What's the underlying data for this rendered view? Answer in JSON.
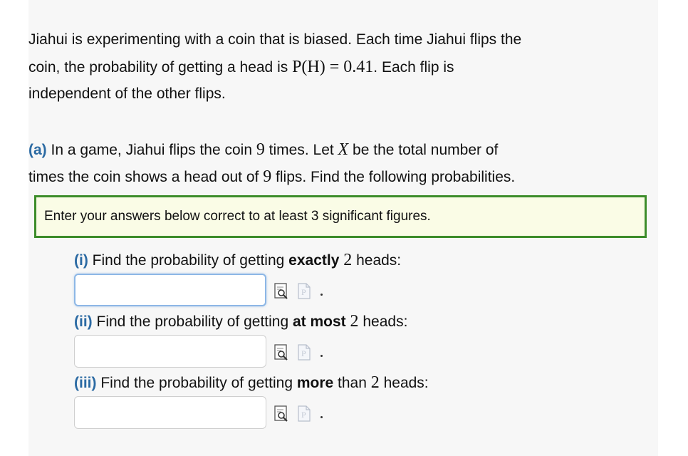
{
  "intro": {
    "text1": "Jiahui is experimenting with a coin that is biased. Each time Jiahui flips the",
    "text2a": "coin, the probability of getting a head is ",
    "math_PH": "P(H) = 0.41",
    "text2b": ". Each flip is",
    "text3": "independent of the other flips."
  },
  "part_a": {
    "label": "(a)",
    "text1a": " In a game, Jiahui flips the coin ",
    "n": "9",
    "text1b": " times.  Let ",
    "var": "X",
    "text1c": " be the total number of",
    "text2a": "times the coin shows a head out of ",
    "text2b": " flips. Find the following probabilities."
  },
  "note": "Enter your answers below correct to at least 3 significant figures.",
  "questions": [
    {
      "label": "(i)",
      "pre": " Find the probability of getting ",
      "bold": "exactly",
      "num": "2",
      "post": " heads:",
      "value": ""
    },
    {
      "label": "(ii)",
      "pre": " Find the probability of getting ",
      "bold": "at most",
      "num": "2",
      "post": " heads:",
      "value": ""
    },
    {
      "label": "(iii)",
      "pre": " Find the probability of getting ",
      "bold": "more",
      "mid": " than ",
      "num": "2",
      "post": " heads:",
      "value": ""
    }
  ],
  "icons": {
    "preview": "preview-icon",
    "parse": "parse-icon"
  },
  "colors": {
    "accent_blue": "#2b6aa3",
    "note_border": "#3c8c2a",
    "note_bg": "#fafce6"
  }
}
